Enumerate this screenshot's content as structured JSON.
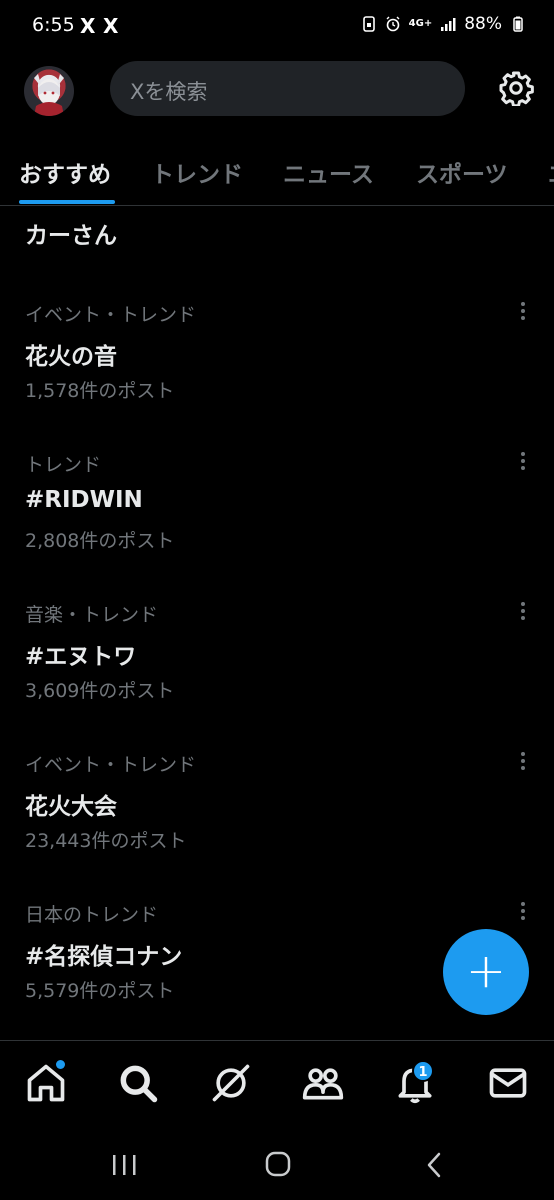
{
  "status_bar": {
    "time": "6:55",
    "notif_icons": [
      "X",
      "X"
    ],
    "network": "4G+",
    "battery": "88%"
  },
  "search": {
    "placeholder": "Xを検索"
  },
  "tabs": [
    {
      "label": "おすすめ",
      "active": true
    },
    {
      "label": "トレンド",
      "active": false
    },
    {
      "label": "ニュース",
      "active": false
    },
    {
      "label": "スポーツ",
      "active": false
    },
    {
      "label": "エ",
      "active": false
    }
  ],
  "partial_item": "カーさん",
  "trends": [
    {
      "category": "イベント・トレンド",
      "name": "花火の音",
      "count": "1,578件のポスト"
    },
    {
      "category": "トレンド",
      "name": "#RIDWIN",
      "count": "2,808件のポスト"
    },
    {
      "category": "音楽・トレンド",
      "name": "#エヌトワ",
      "count": "3,609件のポスト"
    },
    {
      "category": "イベント・トレンド",
      "name": "花火大会",
      "count": "23,443件のポスト"
    },
    {
      "category": "日本のトレンド",
      "name": "#名探偵コナン",
      "count": "5,579件のポスト"
    }
  ],
  "fab_label": "+",
  "bottom_nav": {
    "items": [
      "home-icon",
      "search-icon",
      "grok-icon",
      "communities-icon",
      "notifications-icon",
      "messages-icon"
    ],
    "notification_badge": "1"
  },
  "colors": {
    "accent": "#1d9bf0",
    "background": "#000000",
    "muted": "#71767b",
    "text": "#e7e9ea"
  }
}
